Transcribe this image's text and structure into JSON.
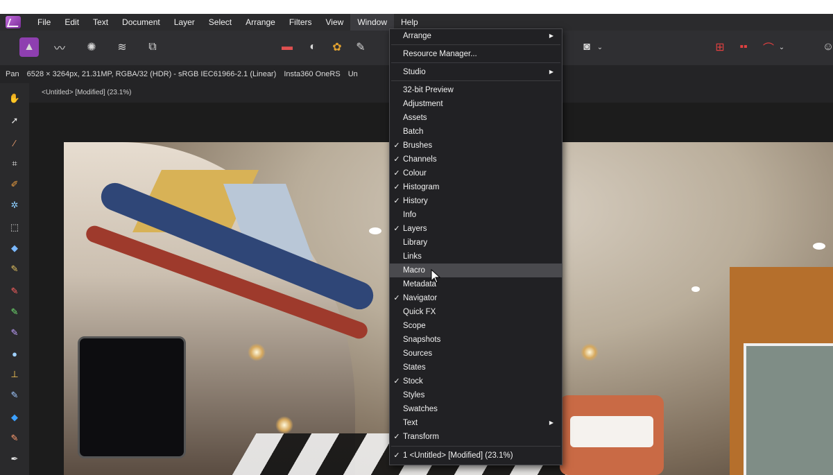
{
  "menubar": {
    "items": [
      "File",
      "Edit",
      "Text",
      "Document",
      "Layer",
      "Select",
      "Arrange",
      "Filters",
      "View",
      "Window",
      "Help"
    ],
    "active": "Window"
  },
  "context": {
    "tool": "Pan",
    "info": "6528 × 3264px, 21.31MP, RGBA/32 (HDR) - sRGB IEC61966-2.1 (Linear)",
    "camera": "Insta360 OneRS",
    "extra": "Un"
  },
  "document": {
    "tab_title": "<Untitled> [Modified] (23.1%)"
  },
  "window_menu": {
    "items": [
      {
        "label": "Arrange",
        "checked": false,
        "submenu": true
      },
      {
        "label": "Resource Manager...",
        "checked": false,
        "submenu": false
      },
      {
        "label": "Studio",
        "checked": false,
        "submenu": true
      },
      {
        "label": "32-bit Preview",
        "checked": false,
        "submenu": false
      },
      {
        "label": "Adjustment",
        "checked": false,
        "submenu": false
      },
      {
        "label": "Assets",
        "checked": false,
        "submenu": false
      },
      {
        "label": "Batch",
        "checked": false,
        "submenu": false
      },
      {
        "label": "Brushes",
        "checked": true,
        "submenu": false
      },
      {
        "label": "Channels",
        "checked": true,
        "submenu": false
      },
      {
        "label": "Colour",
        "checked": true,
        "submenu": false
      },
      {
        "label": "Histogram",
        "checked": true,
        "submenu": false
      },
      {
        "label": "History",
        "checked": true,
        "submenu": false
      },
      {
        "label": "Info",
        "checked": false,
        "submenu": false
      },
      {
        "label": "Layers",
        "checked": true,
        "submenu": false
      },
      {
        "label": "Library",
        "checked": false,
        "submenu": false
      },
      {
        "label": "Links",
        "checked": false,
        "submenu": false
      },
      {
        "label": "Macro",
        "checked": false,
        "submenu": false,
        "highlighted": true
      },
      {
        "label": "Metadata",
        "checked": false,
        "submenu": false
      },
      {
        "label": "Navigator",
        "checked": true,
        "submenu": false
      },
      {
        "label": "Quick FX",
        "checked": false,
        "submenu": false
      },
      {
        "label": "Scope",
        "checked": false,
        "submenu": false
      },
      {
        "label": "Snapshots",
        "checked": false,
        "submenu": false
      },
      {
        "label": "Sources",
        "checked": false,
        "submenu": false
      },
      {
        "label": "States",
        "checked": false,
        "submenu": false
      },
      {
        "label": "Stock",
        "checked": true,
        "submenu": false
      },
      {
        "label": "Styles",
        "checked": false,
        "submenu": false
      },
      {
        "label": "Swatches",
        "checked": false,
        "submenu": false
      },
      {
        "label": "Text",
        "checked": false,
        "submenu": true
      },
      {
        "label": "Transform",
        "checked": true,
        "submenu": false
      },
      {
        "label": "1 <Untitled> [Modified] (23.1%)",
        "checked": true,
        "submenu": false
      }
    ]
  },
  "icons": {
    "persona": "photo-persona-icon",
    "toolbar": [
      "liquify-persona-icon",
      "develop-persona-icon",
      "tone-mapping-persona-icon",
      "export-persona-icon",
      "levels-icon",
      "contrast-icon",
      "colour-wheel-icon",
      "brush-icon",
      "mask-icon",
      "snapping-icon",
      "selection-icon",
      "assistant-icon"
    ],
    "tools": [
      "pan-icon",
      "move-icon",
      "colour-picker-icon",
      "crop-icon",
      "selection-brush-icon",
      "flood-select-icon",
      "marquee-icon",
      "fill-icon",
      "paint-brush-icon",
      "pixel-brush-icon",
      "erase-brush-icon",
      "clone-brush-icon",
      "dodge-brush-icon",
      "stamp-icon",
      "smudge-icon",
      "blur-icon",
      "healing-icon",
      "pen-icon"
    ]
  },
  "colors": {
    "accent": "#8e3fb0",
    "menu_bg": "#212124",
    "highlight": "#4a4a4e"
  }
}
